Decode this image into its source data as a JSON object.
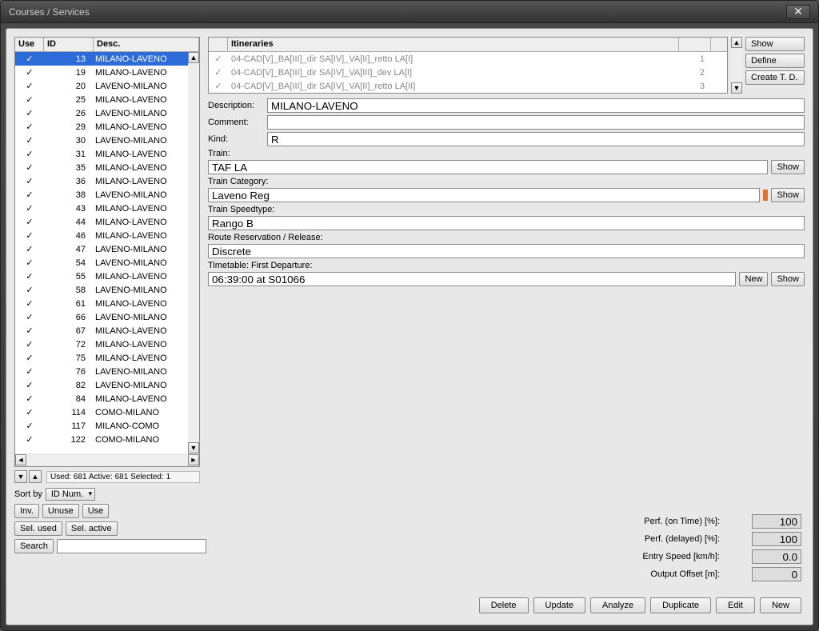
{
  "title": "Courses / Services",
  "columns": {
    "use": "Use",
    "id": "ID",
    "desc": "Desc."
  },
  "courses": [
    {
      "id": "13",
      "desc": "MILANO-LAVENO",
      "sel": true
    },
    {
      "id": "19",
      "desc": "MILANO-LAVENO"
    },
    {
      "id": "20",
      "desc": "LAVENO-MILANO"
    },
    {
      "id": "25",
      "desc": "MILANO-LAVENO"
    },
    {
      "id": "26",
      "desc": "LAVENO-MILANO"
    },
    {
      "id": "29",
      "desc": "MILANO-LAVENO"
    },
    {
      "id": "30",
      "desc": "LAVENO-MILANO"
    },
    {
      "id": "31",
      "desc": "MILANO-LAVENO"
    },
    {
      "id": "35",
      "desc": "MILANO-LAVENO"
    },
    {
      "id": "36",
      "desc": "MILANO-LAVENO"
    },
    {
      "id": "38",
      "desc": "LAVENO-MILANO"
    },
    {
      "id": "43",
      "desc": "MILANO-LAVENO"
    },
    {
      "id": "44",
      "desc": "MILANO-LAVENO"
    },
    {
      "id": "46",
      "desc": "MILANO-LAVENO"
    },
    {
      "id": "47",
      "desc": "LAVENO-MILANO"
    },
    {
      "id": "54",
      "desc": "LAVENO-MILANO"
    },
    {
      "id": "55",
      "desc": "MILANO-LAVENO"
    },
    {
      "id": "58",
      "desc": "LAVENO-MILANO"
    },
    {
      "id": "61",
      "desc": "MILANO-LAVENO"
    },
    {
      "id": "66",
      "desc": "LAVENO-MILANO"
    },
    {
      "id": "67",
      "desc": "MILANO-LAVENO"
    },
    {
      "id": "72",
      "desc": "MILANO-LAVENO"
    },
    {
      "id": "75",
      "desc": "MILANO-LAVENO"
    },
    {
      "id": "76",
      "desc": "LAVENO-MILANO"
    },
    {
      "id": "82",
      "desc": "LAVENO-MILANO"
    },
    {
      "id": "84",
      "desc": "MILANO-LAVENO"
    },
    {
      "id": "114",
      "desc": "COMO-MILANO"
    },
    {
      "id": "117",
      "desc": "MILANO-COMO"
    },
    {
      "id": "122",
      "desc": "COMO-MILANO"
    }
  ],
  "stats": "Used: 681  Active: 681  Selected: 1",
  "sort_label": "Sort by",
  "sort_value": "ID Num.",
  "btns": {
    "inv": "Inv.",
    "unuse": "Unuse",
    "use": "Use",
    "sel_used": "Sel. used",
    "sel_active": "Sel. active",
    "search": "Search"
  },
  "itineraries_header": "Itineraries",
  "itineraries": [
    {
      "name": "04-CAD[V]_BA[III]_dir SA[IV]_VA[II]_retto LA[I]",
      "num": "1"
    },
    {
      "name": "04-CAD[V]_BA[III]_dir SA[IV]_VA[III]_dev LA[I]",
      "num": "2"
    },
    {
      "name": "04-CAD[V]_BA[III]_dir SA[IV]_VA[II]_retto LA[II]",
      "num": "3"
    }
  ],
  "itin_btns": {
    "show": "Show",
    "define": "Define",
    "create": "Create T. D."
  },
  "fields": {
    "description_l": "Description:",
    "description_v": "MILANO-LAVENO",
    "comment_l": "Comment:",
    "comment_v": "",
    "kind_l": "Kind:",
    "kind_v": "R",
    "train_l": "Train:",
    "train_v": "TAF LA",
    "traincat_l": "Train Category:",
    "traincat_v": "Laveno Reg",
    "speed_l": "Train Speedtype:",
    "speed_v": "Rango B",
    "route_l": "Route Reservation / Release:",
    "route_v": "Discrete",
    "tt_l": "Timetable: First Departure:",
    "tt_v": "06:39:00 at S01066"
  },
  "show_btn": "Show",
  "new_btn": "New",
  "perf": {
    "on_time_l": "Perf. (on Time) [%]:",
    "on_time_v": "100",
    "delayed_l": "Perf. (delayed) [%]:",
    "delayed_v": "100",
    "entry_l": "Entry Speed [km/h]:",
    "entry_v": "0.0",
    "offset_l": "Output Offset [m]:",
    "offset_v": "0"
  },
  "bottom": {
    "delete": "Delete",
    "update": "Update",
    "analyze": "Analyze",
    "duplicate": "Duplicate",
    "edit": "Edit",
    "new": "New"
  }
}
